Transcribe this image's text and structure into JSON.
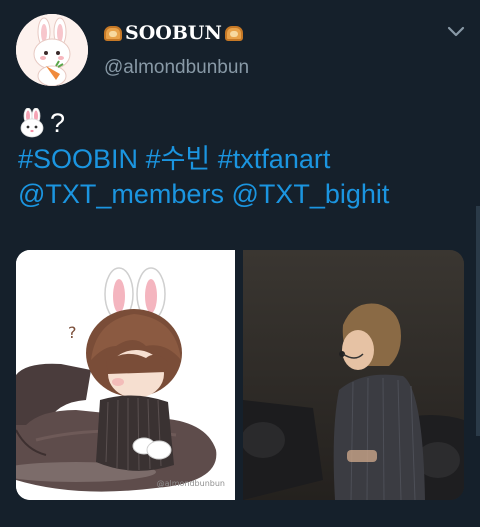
{
  "user": {
    "display_name": "SOOBUN",
    "handle": "@almondbunbun",
    "avatar_icon": "bunny-with-carrot-avatar"
  },
  "tweet": {
    "emoji_icon": "rabbit-face-emoji",
    "question": "?",
    "hashtags": [
      "#SOOBIN",
      "#수빈",
      "#txtfanart"
    ],
    "mentions": [
      "@TXT_members",
      "@TXT_bighit"
    ]
  },
  "media": {
    "left_image": "chibi-bunny-boy-illustration",
    "left_watermark": "@almondbunbun",
    "right_image": "photo-singer-with-headset-mic"
  },
  "colors": {
    "background": "#15202b",
    "link": "#1b95e0",
    "secondary_text": "#8899a6"
  }
}
